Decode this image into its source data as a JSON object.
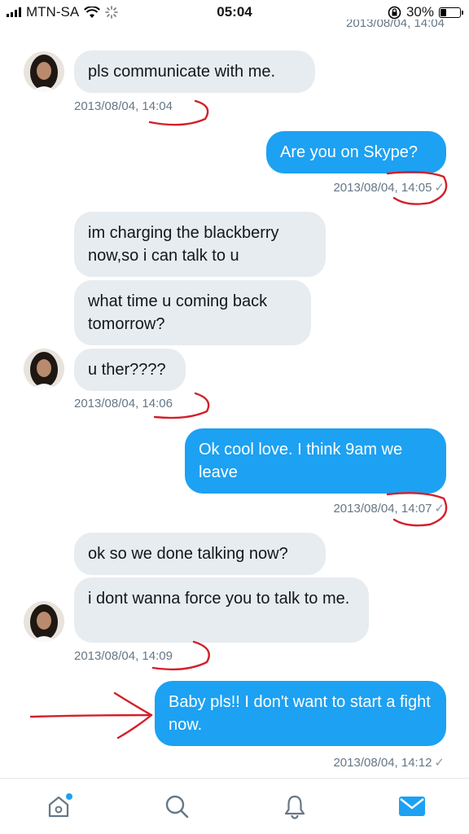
{
  "status_bar": {
    "carrier": "MTN-SA",
    "time": "05:04",
    "battery": "30%",
    "battery_level": 0.3
  },
  "conversation": {
    "top_timestamp": "2013/08/04, 14:04",
    "messages": [
      {
        "direction": "incoming",
        "text": "pls communicate with me."
      },
      {
        "direction": "outgoing",
        "text": "Are you on Skype?"
      },
      {
        "direction": "incoming",
        "text": "im charging the blackberry now,so i can talk to u"
      },
      {
        "direction": "incoming",
        "text": "what time u coming back tomorrow?"
      },
      {
        "direction": "incoming",
        "text": "u ther????"
      },
      {
        "direction": "outgoing",
        "text": "Ok cool love. I think 9am we leave"
      },
      {
        "direction": "incoming",
        "text": "ok so we done talking now?"
      },
      {
        "direction": "incoming",
        "text": "i dont wanna force you to talk to me."
      },
      {
        "direction": "outgoing",
        "text": "Baby pls!! I don't want to start a fight now."
      }
    ],
    "timestamps": [
      "2013/08/04, 14:04",
      "2013/08/04, 14:05",
      "2013/08/04, 14:06",
      "2013/08/04, 14:07",
      "2013/08/04, 14:09",
      "2013/08/04, 14:12"
    ]
  },
  "tab_bar": {
    "tabs": [
      {
        "icon": "home-icon",
        "has_notification": true
      },
      {
        "icon": "search-icon"
      },
      {
        "icon": "bell-icon"
      },
      {
        "icon": "mail-icon",
        "active": true
      }
    ],
    "active_color": "#1da1f2",
    "inactive_color": "#657786"
  }
}
